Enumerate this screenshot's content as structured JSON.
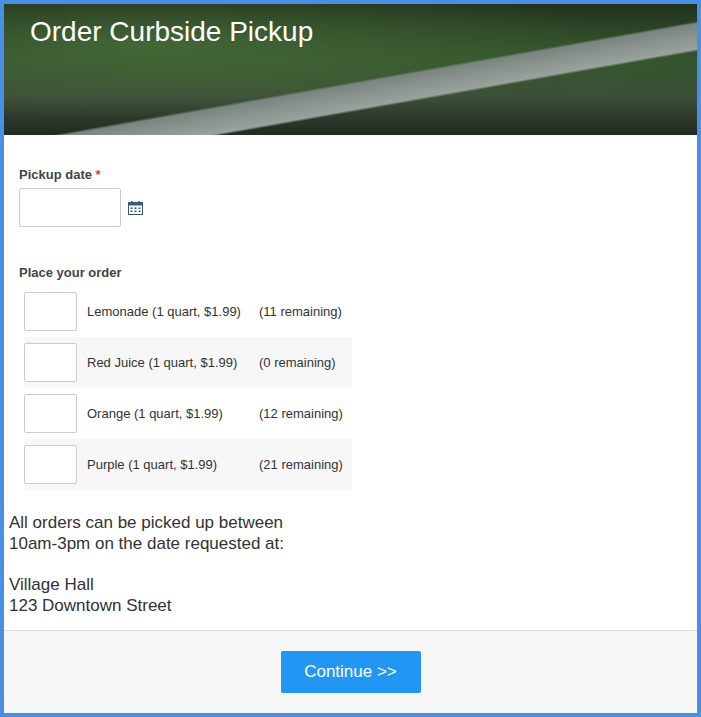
{
  "header": {
    "title": "Order Curbside Pickup"
  },
  "pickup_date": {
    "label": "Pickup date",
    "required_mark": "*",
    "value": ""
  },
  "order": {
    "label": "Place your order",
    "items": [
      {
        "name": "Lemonade (1 quart, $1.99)",
        "remaining": "(11 remaining)",
        "quantity": ""
      },
      {
        "name": "Red Juice (1 quart, $1.99)",
        "remaining": "(0 remaining)",
        "quantity": ""
      },
      {
        "name": "Orange (1 quart, $1.99)",
        "remaining": "(12 remaining)",
        "quantity": ""
      },
      {
        "name": "Purple (1 quart, $1.99)",
        "remaining": "(21 remaining)",
        "quantity": ""
      }
    ]
  },
  "info": {
    "lines": [
      "All orders can be picked up between",
      "10am-3pm on the date requested at:"
    ],
    "address": [
      "Village Hall",
      "123 Downtown Street"
    ]
  },
  "buttons": [
    "Continue >>"
  ]
}
